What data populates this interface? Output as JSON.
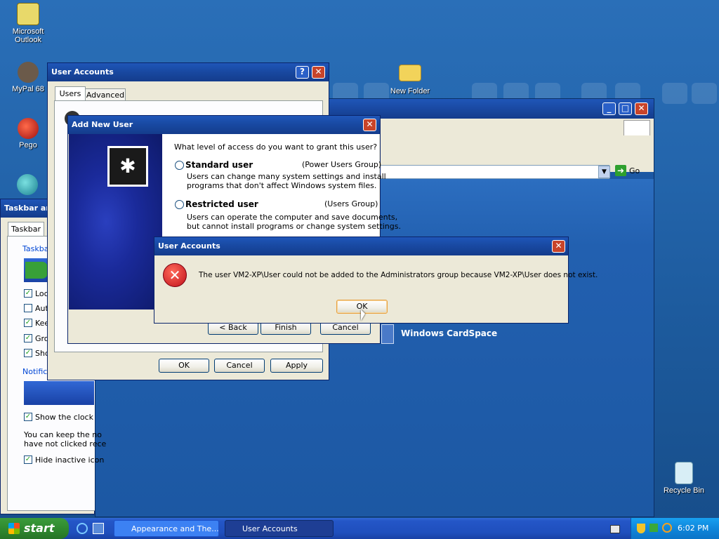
{
  "desktop_icons": [
    {
      "label": "Microsoft Outlook",
      "icon": "outlook-icon"
    },
    {
      "label": "MyPal 68",
      "icon": "mypal-icon"
    },
    {
      "label": "Pego",
      "icon": "pego-icon"
    },
    {
      "label": "New Folder",
      "icon": "folder-icon"
    },
    {
      "label": "Recycle Bin",
      "icon": "recycle-bin-icon"
    }
  ],
  "explorer": {
    "go_label": "Go",
    "cardspace_label": "Windows CardSpace"
  },
  "taskbar_props": {
    "title": "Taskbar an",
    "tab": "Taskbar",
    "group1_label": "Taskba",
    "checks": [
      "Loc",
      "Aut",
      "Kee",
      "Gro",
      "Sho"
    ],
    "checks_state": [
      true,
      false,
      true,
      true,
      true
    ],
    "group2_label": "Notifica",
    "show_clock": "Show the clock",
    "desc_line1": "You can keep the no",
    "desc_line2": "have not clicked rece",
    "hide_inactive": "Hide inactive icon"
  },
  "user_accounts_window": {
    "title": "User Accounts",
    "tabs": [
      "Users",
      "Advanced"
    ],
    "ok": "OK",
    "cancel": "Cancel",
    "apply": "Apply"
  },
  "add_new_user": {
    "title": "Add New User",
    "question": "What level of access do you want to grant this user?",
    "standard_label": "Standard user",
    "standard_group": "(Power Users Group)",
    "standard_desc1": "Users can change many system settings and install",
    "standard_desc2": "programs that don't affect Windows system files.",
    "restricted_label": "Restricted user",
    "restricted_group": "(Users Group)",
    "restricted_desc1": "Users can operate the computer and save documents,",
    "restricted_desc2": "but cannot install programs or change system settings.",
    "back": "< Back",
    "finish": "Finish",
    "cancel": "Cancel"
  },
  "error_dialog": {
    "title": "User Accounts",
    "message": "The user VM2-XP\\User could not be added to the Administrators group because VM2-XP\\User does not exist.",
    "ok": "OK"
  },
  "taskbar": {
    "start": "start",
    "tasks": [
      "Appearance and The...",
      "User Accounts"
    ],
    "clock": "6:02 PM"
  }
}
